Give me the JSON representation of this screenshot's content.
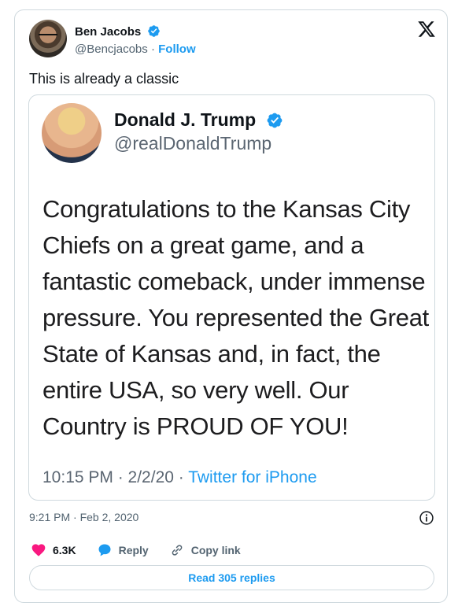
{
  "author": {
    "name": "Ben Jacobs",
    "handle": "@Bencjacobs",
    "separator": " · ",
    "follow_label": "Follow",
    "tweet_text": "This is already a classic"
  },
  "quoted": {
    "name": "Donald J. Trump",
    "handle": "@realDonaldTrump",
    "text": "Congratulations to the Kansas City Chiefs on a great game, and a fantastic comeback, under immense pressure. You represented the Great State of Kansas and, in fact, the entire USA, so very well. Our Country is PROUD OF YOU!",
    "time": "10:15 PM · 2/2/20 · ",
    "source": "Twitter for iPhone"
  },
  "meta": {
    "timestamp": "9:21 PM · Feb 2, 2020"
  },
  "actions": {
    "likes": "6.3K",
    "reply_label": "Reply",
    "copy_link_label": "Copy link"
  },
  "read_replies_label": "Read 305 replies",
  "colors": {
    "accent": "#1d9bf0",
    "like": "#f91880",
    "text": "#0f1419",
    "muted": "#536471"
  },
  "icons": [
    "verified-icon",
    "x-logo-icon",
    "info-icon",
    "heart-icon",
    "reply-bubble-icon",
    "link-icon"
  ]
}
